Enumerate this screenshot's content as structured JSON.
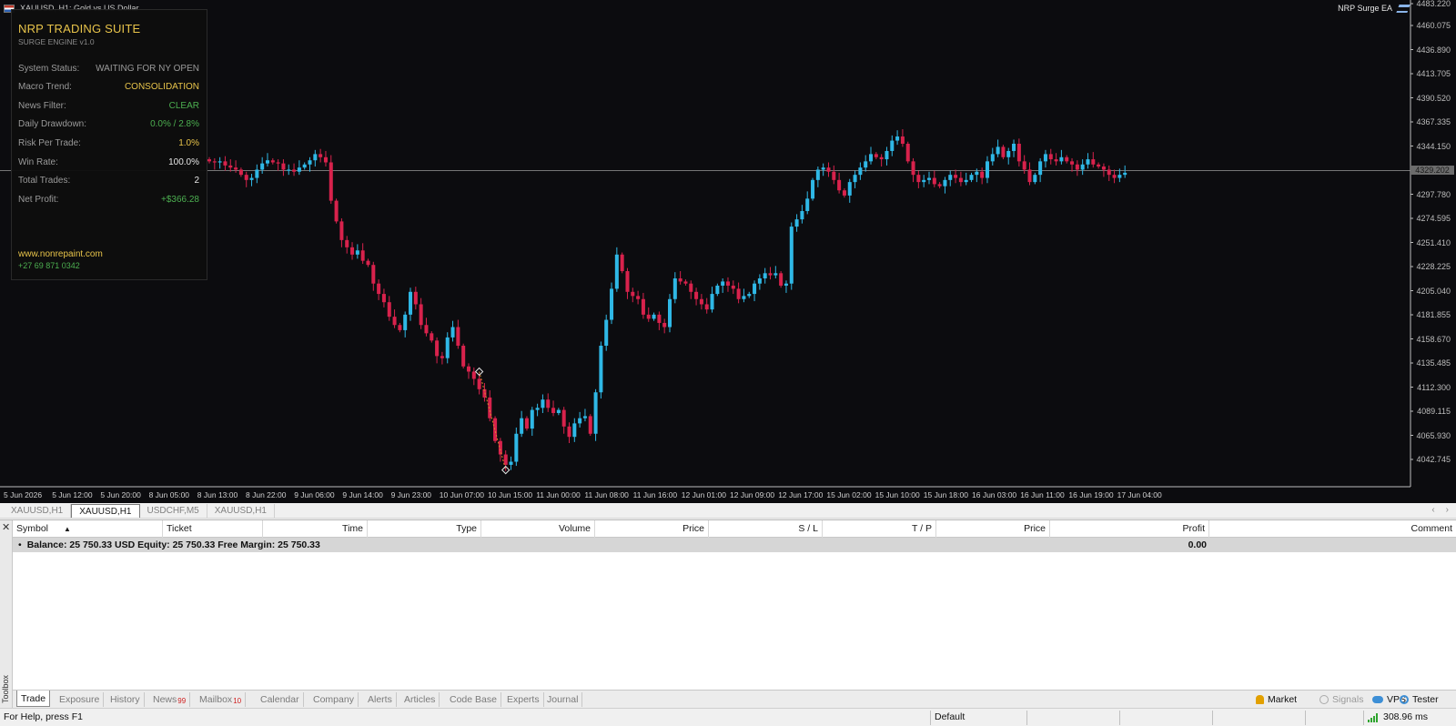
{
  "window": {
    "title": "XAUUSD, H1: Gold vs US Dollar",
    "ea_name": "NRP Surge EA"
  },
  "ea_panel": {
    "title": "NRP TRADING SUITE",
    "subtitle": "SURGE ENGINE v1.0",
    "rows": [
      {
        "label": "System Status:",
        "value": "WAITING FOR NY OPEN",
        "color": "#9a9a9a"
      },
      {
        "label": "Macro Trend:",
        "value": "CONSOLIDATION",
        "color": "#e8c44a"
      },
      {
        "label": "News Filter:",
        "value": "CLEAR",
        "color": "#4caf50"
      },
      {
        "label": "Daily Drawdown:",
        "value": "0.0% / 2.8%",
        "color": "#4caf50"
      },
      {
        "label": "Risk Per Trade:",
        "value": "1.0%",
        "color": "#e8c44a"
      },
      {
        "label": "Win Rate:",
        "value": "100.0%",
        "color": "#e6e6e6"
      },
      {
        "label": "Total Trades:",
        "value": "2",
        "color": "#e6e6e6"
      },
      {
        "label": "Net Profit:",
        "value": "+$366.28",
        "color": "#4caf50"
      }
    ],
    "website": "www.nonrepaint.com",
    "phone": "+27 69 871 0342"
  },
  "price_axis": {
    "top_label": "4483.220",
    "labels": [
      "4460.075",
      "4436.890",
      "4413.705",
      "4390.520",
      "4367.335",
      "4344.150",
      "4320.965",
      "4297.780",
      "4274.595",
      "4251.410",
      "4228.225",
      "4205.040",
      "4181.855",
      "4158.670",
      "4135.485",
      "4112.300",
      "4089.115",
      "4065.930",
      "4042.745"
    ],
    "current_price": "4329.202"
  },
  "time_axis": {
    "labels": [
      "5 Jun 2026",
      "5 Jun 12:00",
      "5 Jun 20:00",
      "8 Jun 05:00",
      "8 Jun 13:00",
      "8 Jun 22:00",
      "9 Jun 06:00",
      "9 Jun 14:00",
      "9 Jun 23:00",
      "10 Jun 07:00",
      "10 Jun 15:00",
      "11 Jun 00:00",
      "11 Jun 08:00",
      "11 Jun 16:00",
      "12 Jun 01:00",
      "12 Jun 09:00",
      "12 Jun 17:00",
      "15 Jun 02:00",
      "15 Jun 10:00",
      "15 Jun 18:00",
      "16 Jun 03:00",
      "16 Jun 11:00",
      "16 Jun 19:00",
      "17 Jun 04:00"
    ]
  },
  "chart_data": {
    "type": "candlestick",
    "symbol": "XAUUSD",
    "timeframe": "H1",
    "ylim": [
      4030,
      4485
    ],
    "current_price": 4329.202,
    "colors": {
      "up": "#2fb8e6",
      "down": "#d8224c",
      "background": "#0c0c0f",
      "current_line": "#9a9a9a"
    },
    "close_path": [
      4338,
      4337,
      4338,
      4334,
      4332,
      4330,
      4325,
      4320,
      4322,
      4330,
      4336,
      4339,
      4337,
      4336,
      4330,
      4330,
      4328,
      4332,
      4335,
      4339,
      4345,
      4342,
      4337,
      4300,
      4280,
      4262,
      4255,
      4248,
      4252,
      4242,
      4238,
      4220,
      4210,
      4202,
      4188,
      4180,
      4175,
      4190,
      4212,
      4200,
      4180,
      4172,
      4165,
      4150,
      4148,
      4168,
      4178,
      4160,
      4140,
      4135,
      4128,
      4118,
      4110,
      4090,
      4068,
      4055,
      4045,
      4048,
      4075,
      4090,
      4080,
      4098,
      4100,
      4108,
      4100,
      4095,
      4098,
      4082,
      4072,
      4085,
      4090,
      4092,
      4075,
      4115,
      4160,
      4185,
      4215,
      4248,
      4232,
      4212,
      4208,
      4205,
      4190,
      4186,
      4190,
      4182,
      4178,
      4205,
      4225,
      4222,
      4220,
      4212,
      4205,
      4200,
      4195,
      4210,
      4218,
      4222,
      4218,
      4215,
      4205,
      4208,
      4210,
      4220,
      4225,
      4230,
      4228,
      4230,
      4218,
      4220,
      4275,
      4282,
      4290,
      4302,
      4320,
      4330,
      4332,
      4328,
      4320,
      4310,
      4305,
      4318,
      4325,
      4332,
      4338,
      4345,
      4342,
      4340,
      4348,
      4358,
      4362,
      4355,
      4338,
      4325,
      4318,
      4320,
      4322,
      4316,
      4314,
      4320,
      4325,
      4322,
      4318,
      4320,
      4325,
      4328,
      4322,
      4338,
      4345,
      4352,
      4342,
      4348,
      4355,
      4338,
      4330,
      4318,
      4325,
      4338,
      4345,
      4340,
      4338,
      4342,
      4338,
      4335,
      4330,
      4335,
      4340,
      4335,
      4333,
      4330,
      4325,
      4322,
      4325,
      4327
    ]
  },
  "chart_tabs": [
    {
      "label": "XAUUSD,H1",
      "active": false
    },
    {
      "label": "XAUUSD,H1",
      "active": true
    },
    {
      "label": "USDCHF,M5",
      "active": false
    },
    {
      "label": "XAUUSD,H1",
      "active": false
    }
  ],
  "toolbox": {
    "label": "Toolbox",
    "columns": [
      "Symbol",
      "Ticket",
      "Time",
      "Type",
      "Volume",
      "Price",
      "S / L",
      "T / P",
      "Price",
      "Profit",
      "Comment"
    ],
    "balance_text": "Balance: 25 750.33 USD  Equity: 25 750.33  Free Margin: 25 750.33",
    "profit_total": "0.00",
    "tabs": [
      {
        "label": "Trade",
        "badge": "",
        "active": true
      },
      {
        "label": "Exposure",
        "badge": "",
        "active": false
      },
      {
        "label": "History",
        "badge": "",
        "active": false
      },
      {
        "label": "News",
        "badge": "99",
        "active": false
      },
      {
        "label": "Mailbox",
        "badge": "10",
        "active": false
      },
      {
        "label": "Calendar",
        "badge": "",
        "active": false
      },
      {
        "label": "Company",
        "badge": "",
        "active": false
      },
      {
        "label": "Alerts",
        "badge": "",
        "active": false
      },
      {
        "label": "Articles",
        "badge": "",
        "active": false
      },
      {
        "label": "Code Base",
        "badge": "",
        "active": false
      },
      {
        "label": "Experts",
        "badge": "",
        "active": false
      },
      {
        "label": "Journal",
        "badge": "",
        "active": false
      }
    ],
    "right_tools": {
      "market": "Market",
      "signals": "Signals",
      "vps": "VPS",
      "tester": "Tester"
    }
  },
  "status_bar": {
    "help": "For Help, press F1",
    "profile": "Default",
    "ping": "308.96 ms"
  }
}
